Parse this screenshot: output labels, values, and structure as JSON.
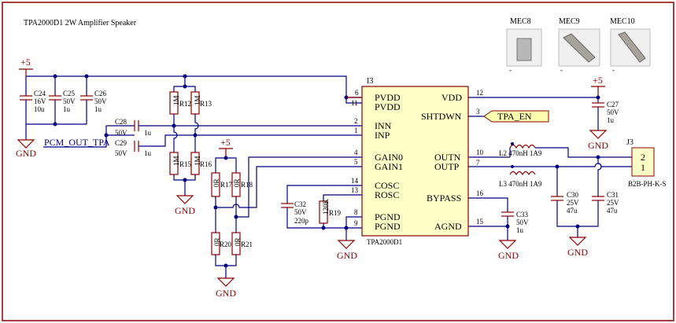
{
  "title": "TPA2000D1 2W Amplifier Speaker",
  "ic": {
    "ref": "I3",
    "part": "TPA2000D1",
    "left_pins": [
      {
        "num": "6",
        "name": "PVDD"
      },
      {
        "num": "11",
        "name": "PVDD"
      },
      {
        "num": "2",
        "name": "INN"
      },
      {
        "num": "1",
        "name": "INP"
      },
      {
        "num": "4",
        "name": "GAIN0"
      },
      {
        "num": "5",
        "name": "GAIN1"
      },
      {
        "num": "14",
        "name": "COSC"
      },
      {
        "num": "13",
        "name": "ROSC"
      },
      {
        "num": "8",
        "name": "PGND"
      },
      {
        "num": "9",
        "name": "PGND"
      }
    ],
    "right_pins": [
      {
        "num": "12",
        "name": "VDD"
      },
      {
        "num": "3",
        "name": "SHTDWN"
      },
      {
        "num": "10",
        "name": "OUTN"
      },
      {
        "num": "7",
        "name": "OUTP"
      },
      {
        "num": "16",
        "name": "BYPASS"
      },
      {
        "num": "15",
        "name": "AGND"
      }
    ]
  },
  "power": {
    "label": "+5",
    "gnd": "GND"
  },
  "caps": {
    "c24": [
      "C24",
      "16V",
      "10u"
    ],
    "c25": [
      "C25",
      "50V",
      "1u"
    ],
    "c26": [
      "C26",
      "50V",
      "1u"
    ],
    "c28": [
      "C28",
      "50V",
      "1u"
    ],
    "c29": [
      "C29",
      "50V",
      "1u"
    ],
    "c27": [
      "C27",
      "50V",
      "1u"
    ],
    "c32": [
      "C32",
      "50V",
      "220p"
    ],
    "c33": [
      "C33",
      "50V",
      "1u"
    ],
    "c30": [
      "C30",
      "25V",
      "47u"
    ],
    "c31": [
      "C31",
      "25V",
      "47u"
    ]
  },
  "resistors": {
    "r12": [
      "R12",
      "1M"
    ],
    "r13": [
      "R13",
      "1M"
    ],
    "r15": [
      "R15",
      "1M"
    ],
    "r16": [
      "R16",
      "1M"
    ],
    "r17": [
      "R17",
      "0R"
    ],
    "r18": [
      "R18",
      "0R"
    ],
    "r20": [
      "R20",
      "0R"
    ],
    "r21": [
      "R21",
      "0R"
    ],
    "r19": [
      "R19",
      "120K"
    ]
  },
  "inductors": {
    "l2": "L2 470nH 1A9",
    "l3": "L3 470nH 1A9"
  },
  "connector": {
    "ref": "J3",
    "part": "B2B-PH-K-S",
    "pins": [
      "2",
      "1"
    ]
  },
  "net_labels": {
    "pcm_out": "PCM_OUT_TPA",
    "tpa_en": "TPA_EN"
  },
  "mech": [
    {
      "ref": "MEC8",
      "sub": "-"
    },
    {
      "ref": "MEC9",
      "sub": "-"
    },
    {
      "ref": "MEC10",
      "sub": "-"
    }
  ]
}
